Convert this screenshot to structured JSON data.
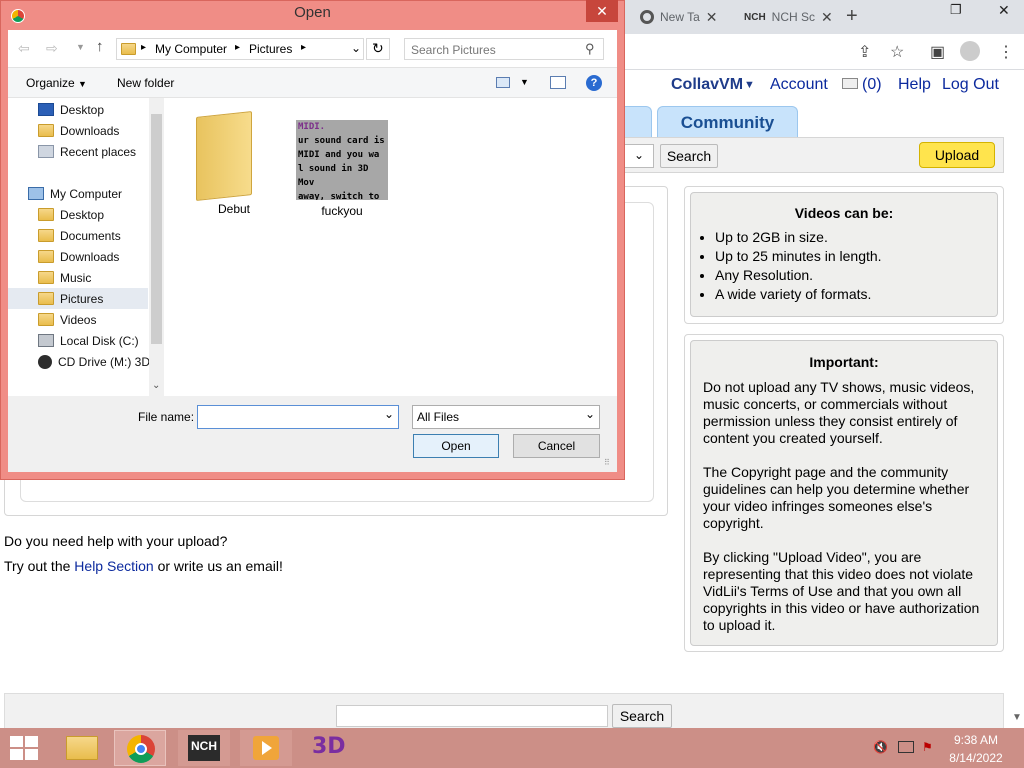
{
  "browser": {
    "tabs": [
      {
        "label": "New Ta"
      },
      {
        "label": "NCH Sc"
      }
    ],
    "new_tab_icon": "plus-icon"
  },
  "site": {
    "nav": {
      "brand": "CollavVM",
      "account": "Account",
      "messages": "(0)",
      "help": "Help",
      "logout": "Log Out"
    },
    "tabs": {
      "community": "Community"
    },
    "search_btn": "Search",
    "upload_btn": "Upload",
    "videos_can_be": {
      "title": "Videos can be:",
      "items": [
        "Up to 2GB in size.",
        "Up to 25 minutes in length.",
        "Any Resolution.",
        "A wide variety of formats."
      ]
    },
    "important": {
      "title": "Important:",
      "p1": "Do not upload any TV shows, music videos, music concerts, or commercials without permission unless they consist entirely of content you created yourself.",
      "p2": "The Copyright page and the community guidelines can help you determine whether your video infringes someones else's copyright.",
      "p3": "By clicking \"Upload Video\", you are representing that this video does not violate VidLii's Terms of Use and that you own all copyrights in this video or have authorization to upload it."
    },
    "help": {
      "line1": "Do you need help with your upload?",
      "line2_pre": "Try out the ",
      "line2_link": "Help Section",
      "line2_post": " or write us an email!"
    },
    "footer_search_btn": "Search"
  },
  "dialog": {
    "title": "Open",
    "breadcrumb": [
      "My Computer",
      "Pictures"
    ],
    "search_placeholder": "Search Pictures",
    "organize": "Organize",
    "new_folder": "New folder",
    "nav_items": [
      "Desktop",
      "Downloads",
      "Recent places",
      "My Computer",
      "Desktop",
      "Documents",
      "Downloads",
      "Music",
      "Pictures",
      "Videos",
      "Local Disk (C:)",
      "CD Drive (M:) 3D"
    ],
    "files": [
      {
        "name": "Debut",
        "type": "folder"
      },
      {
        "name": "fuckyou",
        "type": "image",
        "preview_lines": [
          "MIDI.",
          "ur sound card is",
          "MIDI and you wa",
          "l sound in 3D Mov",
          "away, switch to"
        ]
      }
    ],
    "file_name_label": "File name:",
    "file_name_value": "",
    "file_type": "All Files",
    "open_btn": "Open",
    "cancel_btn": "Cancel"
  },
  "taskbar": {
    "time": "9:38 AM",
    "date": "8/14/2022",
    "apps": [
      "file-explorer-icon",
      "chrome-icon",
      "nch-icon",
      "media-player-icon",
      "3d-movie-maker-icon"
    ],
    "nch_label": "NCH"
  }
}
